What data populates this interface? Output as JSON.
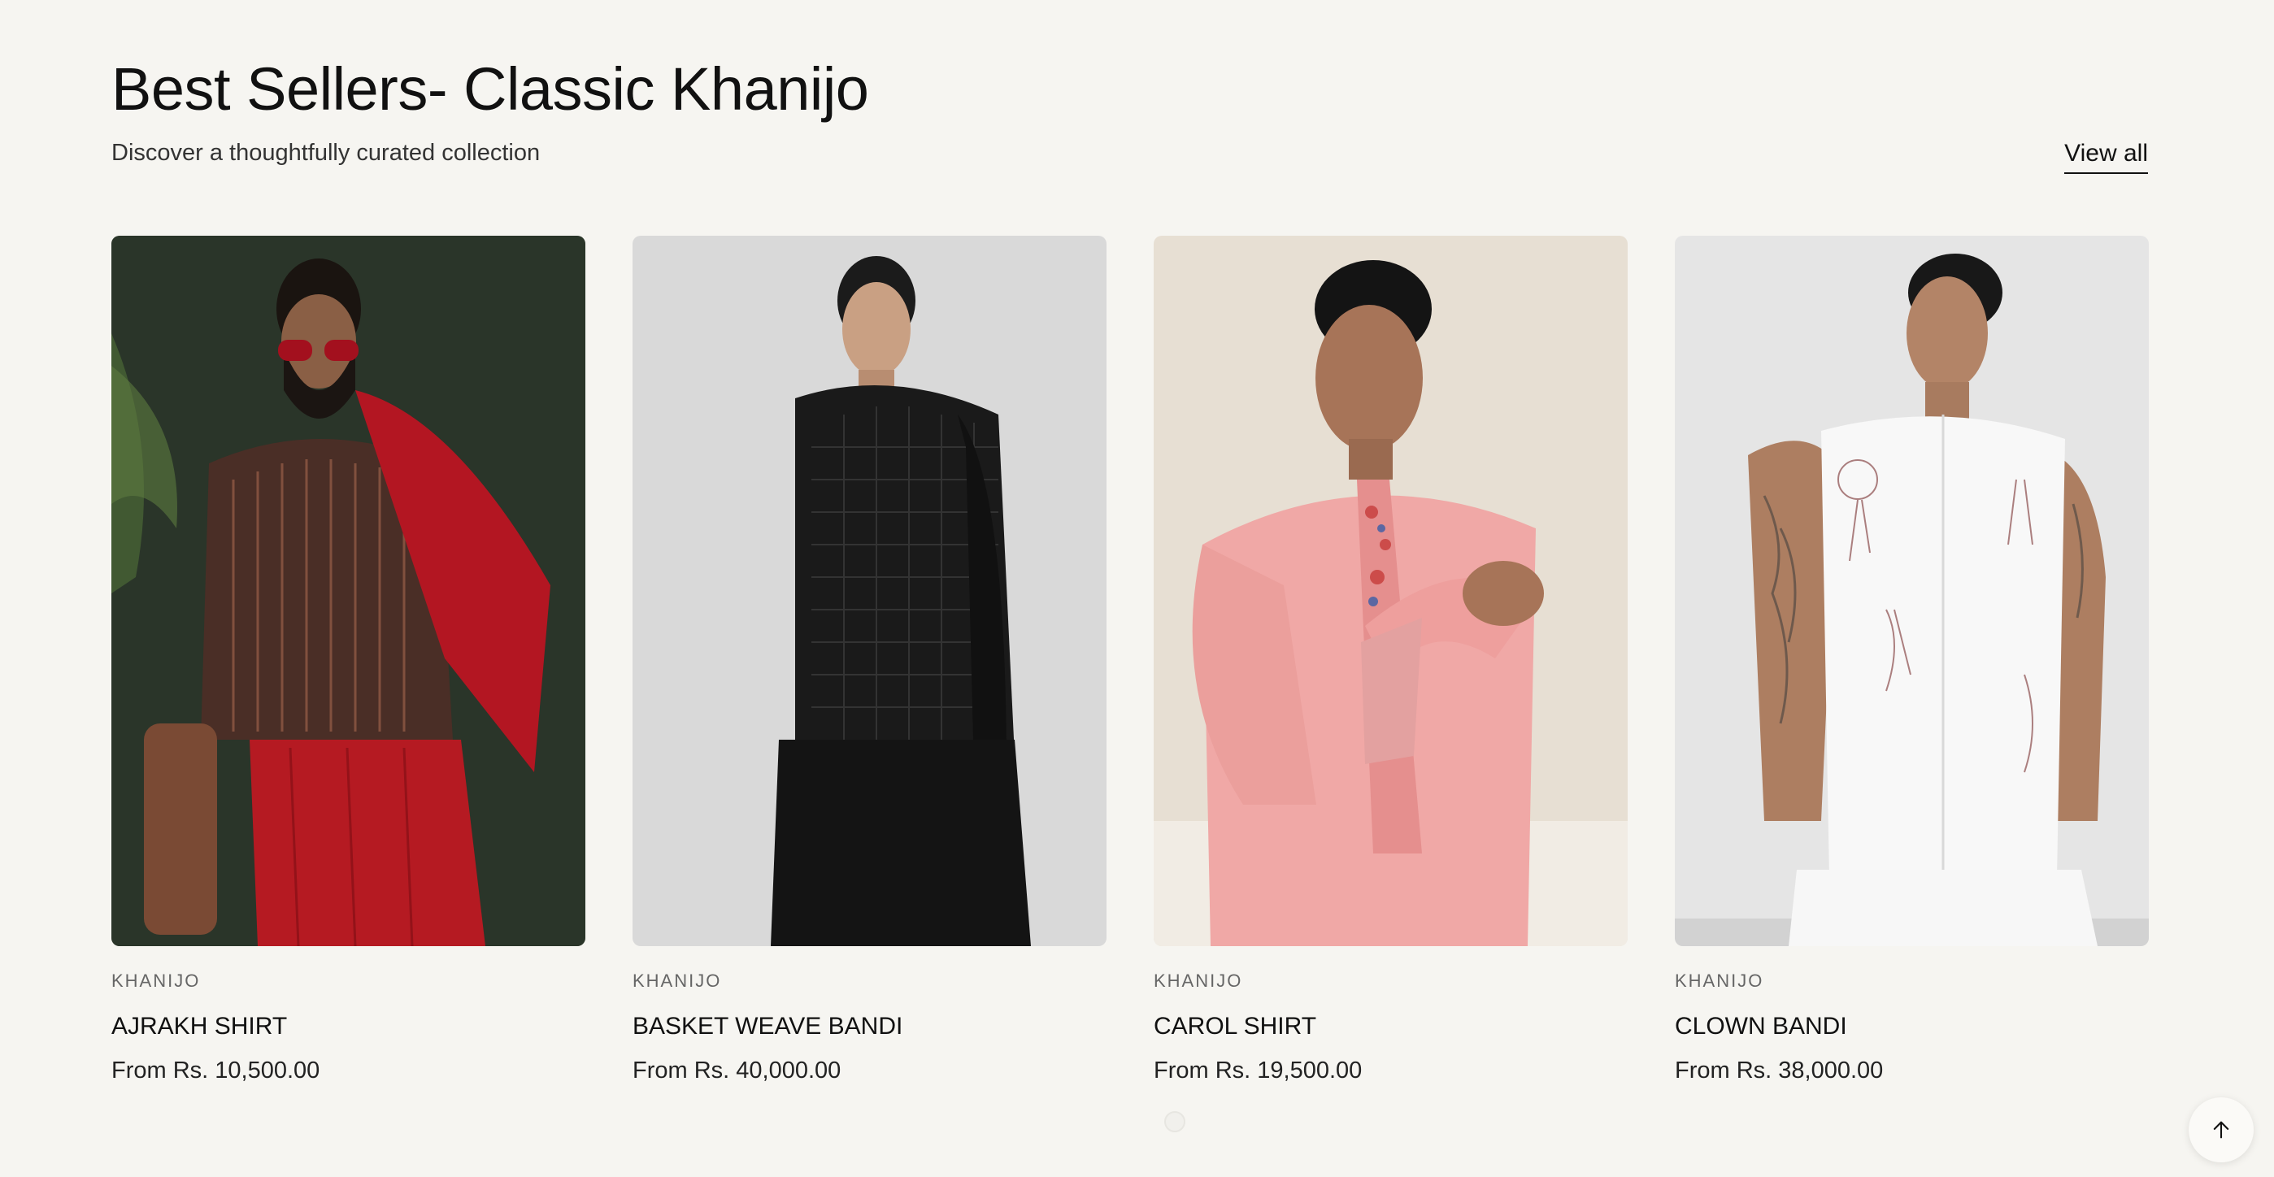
{
  "section": {
    "title": "Best Sellers- Classic Khanijo",
    "subtitle": "Discover a thoughtfully curated collection",
    "view_all_label": "View all"
  },
  "products": [
    {
      "vendor": "KHANIJO",
      "name": "AJRAKH SHIRT",
      "price": "From Rs. 10,500.00"
    },
    {
      "vendor": "KHANIJO",
      "name": "BASKET WEAVE BANDI",
      "price": "From Rs. 40,000.00"
    },
    {
      "vendor": "KHANIJO",
      "name": "CAROL SHIRT",
      "price": "From Rs. 19,500.00"
    },
    {
      "vendor": "KHANIJO",
      "name": "CLOWN BANDI",
      "price": "From Rs. 38,000.00"
    }
  ],
  "icons": {
    "back_to_top": "arrow-up-icon"
  },
  "colors": {
    "background": "#f6f5f1",
    "text": "#111111"
  }
}
